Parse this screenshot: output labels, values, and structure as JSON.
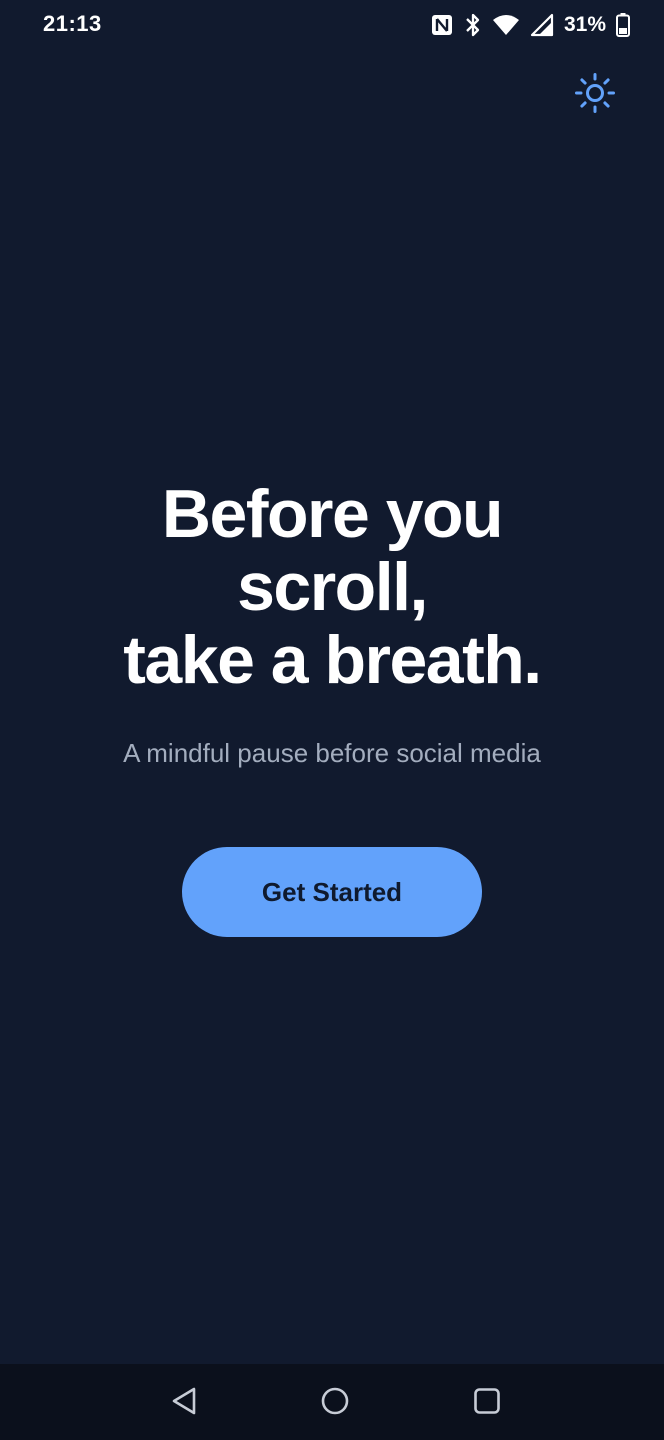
{
  "status_bar": {
    "time": "21:13",
    "battery_percent": "31%",
    "icons": [
      "nfc-icon",
      "bluetooth-icon",
      "wifi-icon",
      "cellular-signal-icon",
      "battery-icon"
    ]
  },
  "header": {
    "theme_toggle_icon": "sun-icon"
  },
  "hero": {
    "title_lines": [
      "Before you",
      "scroll,",
      "take a breath."
    ],
    "subtitle": "A mindful pause before social media",
    "cta_label": "Get Started"
  },
  "nav_bar": {
    "buttons": [
      "back-icon",
      "home-icon",
      "recents-icon"
    ]
  },
  "colors": {
    "background": "#111a2e",
    "accent": "#62a2fb",
    "title_text": "#ffffff",
    "subtitle_text": "#a3adbe",
    "nav_background": "#0b101c"
  }
}
